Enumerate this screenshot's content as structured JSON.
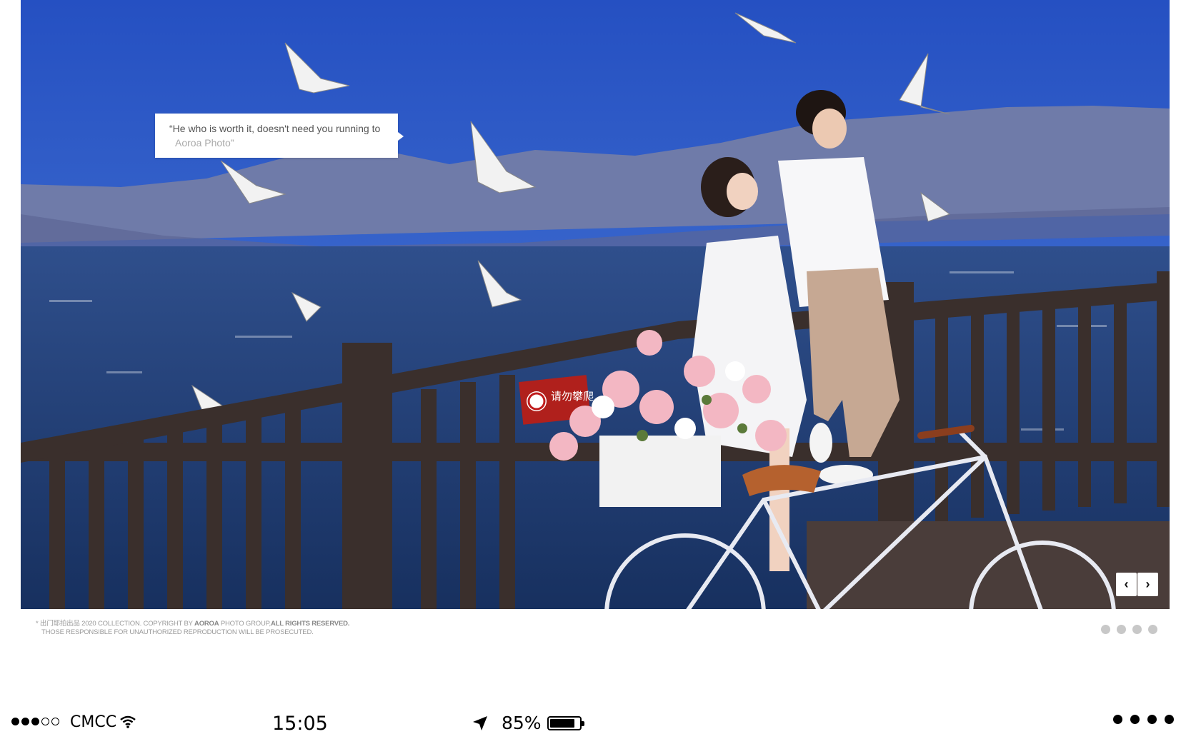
{
  "photo": {
    "quote_line1": "“He who is worth it, doesn't need you running to",
    "quote_line2": "Aoroa Photo”",
    "sign_text": "请勿攀爬",
    "prev_icon": "chevron-left-icon",
    "next_icon": "chevron-right-icon",
    "prev_glyph": "‹",
    "next_glyph": "›",
    "colors": {
      "sky": "#2a5cc4",
      "sea": "#1f3f7a",
      "mountain": "#6e7aa6",
      "railing": "#3a2e2a"
    }
  },
  "footer": {
    "copyright_pre": "* 出门耶拍出品 2020 COLLECTION. COPYRIGHT BY",
    "copyright_brand": "AOROA",
    "copyright_mid": "PHOTO GROUP,",
    "copyright_rights": "ALL RIGHTS RESERVED.",
    "copyright_line2": "THOSE RESPONSIBLE FOR UNAUTHORIZED REPRODUCTION WILL BE PROSECUTED.",
    "pager_count": 4
  },
  "status_bar": {
    "signal_bars_filled": 3,
    "signal_bars_total": 5,
    "carrier": "CMCC",
    "time": "15:05",
    "battery_percent": "85%",
    "battery_level": 0.85,
    "icons": [
      "wifi-icon",
      "location-arrow-icon",
      "battery-icon",
      "more-icon"
    ]
  }
}
